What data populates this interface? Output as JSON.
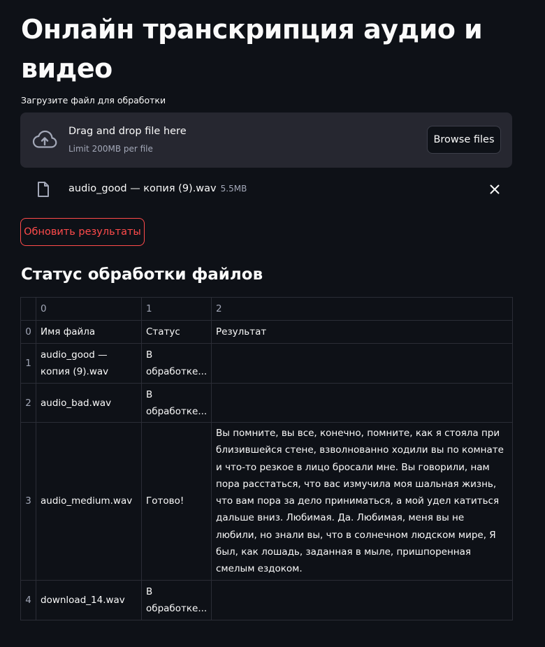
{
  "page": {
    "title": "Онлайн транскрипция аудио и видео"
  },
  "uploader": {
    "label": "Загрузите файл для обработки",
    "dropzone_title": "Drag and drop file here",
    "dropzone_limit": "Limit 200MB per file",
    "browse_label": "Browse files",
    "icon": "cloud-upload-icon"
  },
  "uploaded_file": {
    "name": "audio_good — копия (9).wav",
    "size": "5.5MB",
    "icon": "file-icon",
    "remove_icon": "close-icon"
  },
  "refresh_button": {
    "label": "Обновить результаты",
    "color": "#ff4b4b"
  },
  "status_section": {
    "title": "Статус обработки файлов",
    "table": {
      "column_headers": [
        "0",
        "1",
        "2"
      ],
      "rows": [
        {
          "index": "0",
          "cells": [
            "Имя файла",
            "Статус",
            "Результат"
          ]
        },
        {
          "index": "1",
          "cells": [
            "audio_good — копия (9).wav",
            "В обработке...",
            ""
          ]
        },
        {
          "index": "2",
          "cells": [
            "audio_bad.wav",
            "В обработке...",
            ""
          ]
        },
        {
          "index": "3",
          "cells": [
            "audio_medium.wav",
            "Готово!",
            "Вы помните, вы все, конечно, помните, как я стояла при близившейся стене, взволнованно ходили вы по комнате и что-то резкое в лицо бросали мне. Вы говорили, нам пора расстаться, что вас измучила моя шальная жизнь, что вам пора за дело приниматься, а мой удел катиться дальше вниз. Любимая. Да. Любимая, меня вы не любили, но знали вы, что в солнечном людском мире, Я был, как лошадь, заданная в мыле, пришпоренная смелым ездоком."
          ]
        },
        {
          "index": "4",
          "cells": [
            "download_14.wav",
            "В обработке...",
            ""
          ]
        }
      ]
    }
  },
  "colors": {
    "background": "#0e1117",
    "panel": "#262730",
    "text": "#fafafa",
    "muted": "#a3a8b8",
    "accent": "#ff4b4b"
  }
}
